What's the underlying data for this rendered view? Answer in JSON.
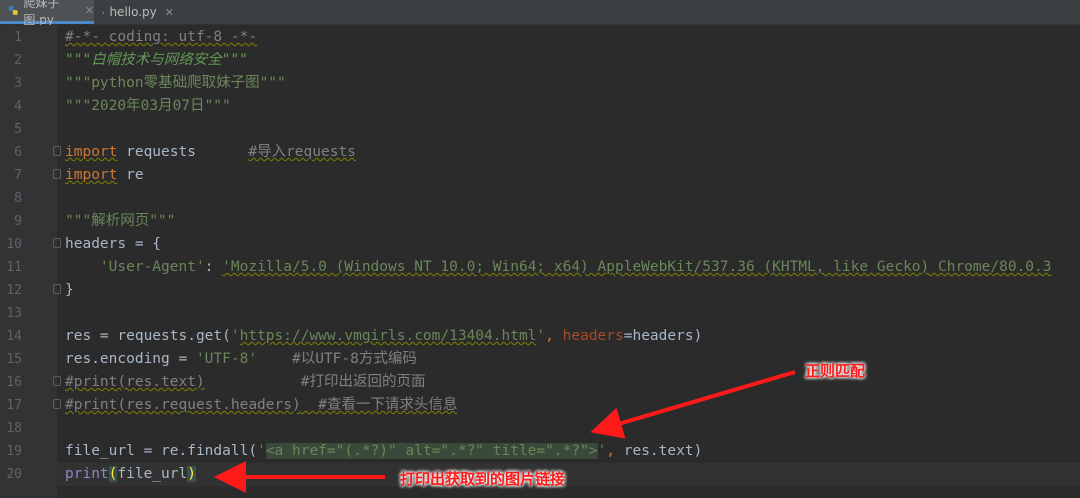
{
  "tabs": [
    {
      "label": "爬妹子图.py",
      "active": true
    },
    {
      "label": "hello.py",
      "active": false
    }
  ],
  "lines": [
    {
      "n": "1",
      "parts": [
        {
          "t": "#-*- coding: utf-8 -*-",
          "c": "c u"
        }
      ]
    },
    {
      "n": "2",
      "parts": [
        {
          "t": "\"\"\"白帽技术与网络安全\"\"\"",
          "c": "d"
        }
      ]
    },
    {
      "n": "3",
      "parts": [
        {
          "t": "\"\"\"python零基础爬取妹子图\"\"\"",
          "c": "s"
        }
      ]
    },
    {
      "n": "4",
      "parts": [
        {
          "t": "\"\"\"2020年03月07日\"\"\"",
          "c": "s"
        }
      ]
    },
    {
      "n": "5",
      "parts": []
    },
    {
      "n": "6",
      "parts": [
        {
          "t": "import",
          "c": "k u"
        },
        {
          "t": " requests      ",
          "c": ""
        },
        {
          "t": "#导入requests",
          "c": "c u"
        }
      ]
    },
    {
      "n": "7",
      "parts": [
        {
          "t": "import",
          "c": "k u"
        },
        {
          "t": " re",
          "c": ""
        }
      ]
    },
    {
      "n": "8",
      "parts": []
    },
    {
      "n": "9",
      "parts": [
        {
          "t": "\"\"\"解析网页\"\"\"",
          "c": "s"
        }
      ]
    },
    {
      "n": "10",
      "parts": [
        {
          "t": "headers = {",
          "c": ""
        }
      ]
    },
    {
      "n": "11",
      "parts": [
        {
          "t": "    ",
          "c": ""
        },
        {
          "t": "'User-Agent'",
          "c": "s"
        },
        {
          "t": ": ",
          "c": ""
        },
        {
          "t": "'Mozilla/5.0 (Windows NT 10.0; Win64; x64) AppleWebKit/537.36 (KHTML, like Gecko) Chrome/80.0.3",
          "c": "s u"
        }
      ]
    },
    {
      "n": "12",
      "parts": [
        {
          "t": "}",
          "c": ""
        }
      ]
    },
    {
      "n": "13",
      "parts": []
    },
    {
      "n": "14",
      "parts": [
        {
          "t": "res = requests.get(",
          "c": ""
        },
        {
          "t": "'",
          "c": "s"
        },
        {
          "t": "https://www.vmgirls.com/13404.html",
          "c": "s u"
        },
        {
          "t": "'",
          "c": "s"
        },
        {
          "t": ", ",
          "c": "k"
        },
        {
          "t": "headers",
          "c": "p"
        },
        {
          "t": "=headers)",
          "c": ""
        }
      ]
    },
    {
      "n": "15",
      "parts": [
        {
          "t": "res.encoding = ",
          "c": ""
        },
        {
          "t": "'UTF-8'",
          "c": "s"
        },
        {
          "t": "    ",
          "c": ""
        },
        {
          "t": "#以UTF-8方式编码",
          "c": "c"
        }
      ]
    },
    {
      "n": "16",
      "parts": [
        {
          "t": "#print(res.text)",
          "c": "c u"
        },
        {
          "t": "           ",
          "c": "c"
        },
        {
          "t": "#打印出返回的页面",
          "c": "c"
        }
      ]
    },
    {
      "n": "17",
      "parts": [
        {
          "t": "#print(res.request.headers)",
          "c": "c u"
        },
        {
          "t": "  #查看一下请求头信息",
          "c": "c u"
        }
      ]
    },
    {
      "n": "18",
      "parts": []
    },
    {
      "n": "19",
      "parts": [
        {
          "t": "file_url = re.findall(",
          "c": ""
        },
        {
          "t": "'",
          "c": "s"
        },
        {
          "t": "<a href=\"(.*?)\" alt=\".*?\" title=\".*?\">",
          "c": "s hl"
        },
        {
          "t": "'",
          "c": "s"
        },
        {
          "t": ", ",
          "c": "k"
        },
        {
          "t": "res.text)",
          "c": ""
        }
      ]
    },
    {
      "n": "20",
      "parts": [
        {
          "t": "print",
          "c": "b"
        },
        {
          "t": "(",
          "c": "paren"
        },
        {
          "t": "file_url",
          "c": ""
        },
        {
          "t": ")",
          "c": "paren"
        }
      ]
    }
  ],
  "annotations": {
    "regex_label": "正则匹配",
    "print_label": "打印出获取到的图片链接"
  },
  "colors": {
    "background": "#2b2b2b",
    "keyword": "#cc7832",
    "string": "#6a8759",
    "comment": "#808080",
    "annotation": "#ff1a1a"
  }
}
